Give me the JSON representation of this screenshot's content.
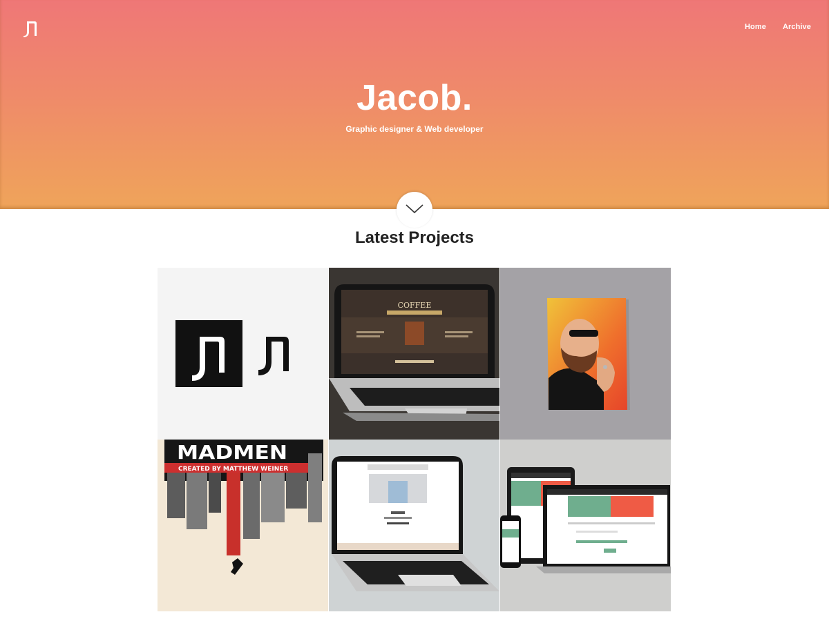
{
  "header": {
    "logo_icon": "jn-monogram-logo",
    "nav": {
      "home": "Home",
      "archive": "Archive"
    },
    "title": "Jacob.",
    "subtitle": "Graphic designer & Web developer",
    "scroll_icon": "chevron-down-icon",
    "gradient": {
      "top": "#ef7777",
      "bottom": "#efa45a"
    }
  },
  "main": {
    "section_title": "Latest Projects",
    "projects": [
      {
        "id": "logo-design",
        "text": ""
      },
      {
        "id": "coffee-website",
        "text": "COFFEE"
      },
      {
        "id": "portrait-illustration",
        "text": ""
      },
      {
        "id": "madmen-poster",
        "text": "MADMEN",
        "caption": "CREATED BY MATTHEW WEINER"
      },
      {
        "id": "blog-website",
        "text": ""
      },
      {
        "id": "responsive-web-app",
        "text": ""
      }
    ]
  }
}
